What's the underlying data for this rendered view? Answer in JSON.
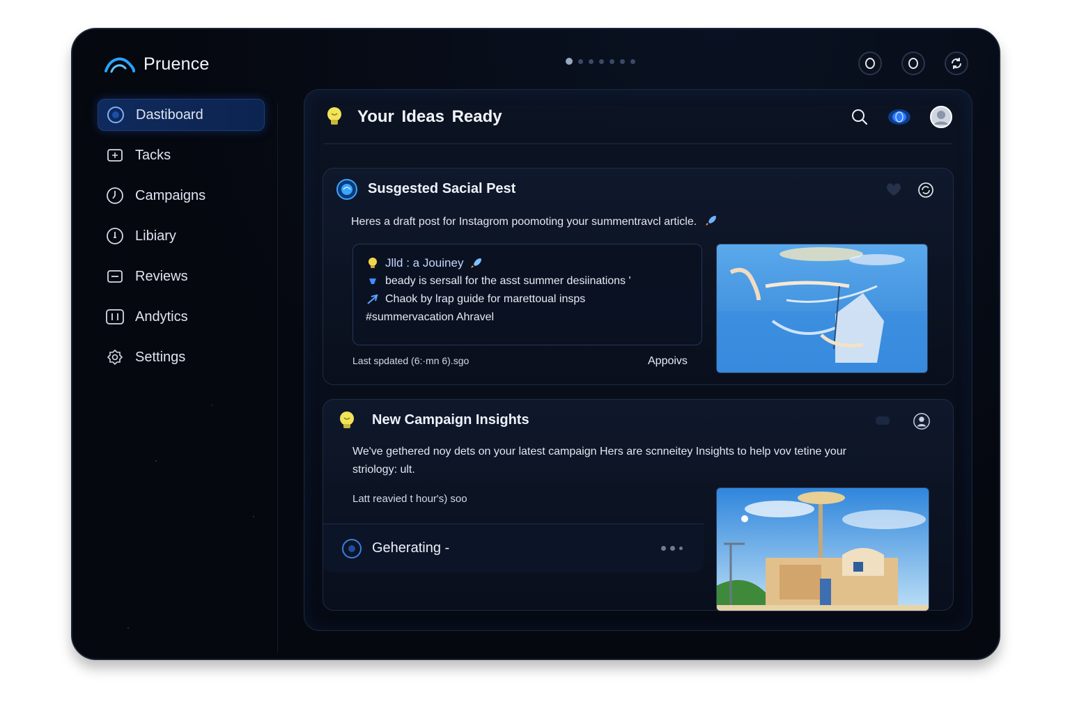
{
  "app": {
    "brand": "Pruence"
  },
  "pager": {
    "count": 7,
    "active_index": 0
  },
  "sidebar": {
    "items": [
      {
        "label": "Dastiboard",
        "icon": "dashboard-icon",
        "active": true
      },
      {
        "label": "Tacks",
        "icon": "tasks-icon"
      },
      {
        "label": "Campaigns",
        "icon": "campaigns-icon"
      },
      {
        "label": "Libiary",
        "icon": "library-icon"
      },
      {
        "label": "Reviews",
        "icon": "reviews-icon"
      },
      {
        "label": "Andytics",
        "icon": "analytics-icon"
      },
      {
        "label": "Settings",
        "icon": "settings-icon"
      }
    ]
  },
  "panel": {
    "title": "Your Ideas  Ready",
    "icons": [
      "lightbulb-icon",
      "search-icon",
      "globe-icon",
      "avatar"
    ]
  },
  "card1": {
    "title": "Susgested Sacial Pest",
    "description": "Heres  a draft post for Instagrom poomoting your summentravcl article.",
    "draft": {
      "title": "Jlld :  a Jouiney",
      "lines": [
        "beady is sersall for the asst summer desiinations '",
        "Chaok by lrap guide for marettoual insps",
        "#summervacation Ahravel"
      ]
    },
    "meta": "Last spdated (6:·mn 6).sgo",
    "approve_label": "Appoivs"
  },
  "card2": {
    "title": "New Campaign Insights",
    "description": "We've gethered noy dets on your latest campaign Hers are scnneitey Insights to help vov tetine your striology: ult.",
    "meta": "Latt reavied t hour's) soo",
    "generating_label": "Geherating -"
  },
  "colors": {
    "accent": "#1c3d78",
    "accent_glow": "#2f7bff",
    "bulb": "#f2e45a"
  }
}
